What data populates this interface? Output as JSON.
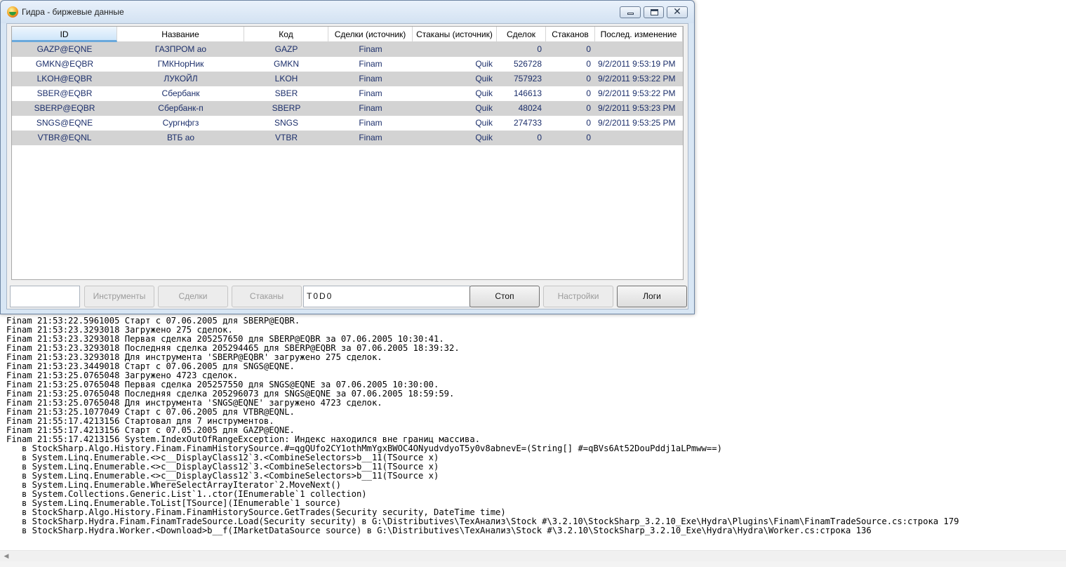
{
  "window": {
    "title": "Гидра - биржевые данные"
  },
  "grid": {
    "columns": [
      "ID",
      "Название",
      "Код",
      "Сделки (источник)",
      "Стаканы (источник)",
      "Сделок",
      "Стаканов",
      "Послед. изменение"
    ],
    "rows": [
      {
        "id": "GAZP@EQNE",
        "name": "ГАЗПРОМ ао",
        "code": "GAZP",
        "trades_src": "Finam",
        "depths_src": "",
        "trades": "0",
        "depths": "0",
        "last": ""
      },
      {
        "id": "GMKN@EQBR",
        "name": "ГМКНорНик",
        "code": "GMKN",
        "trades_src": "Finam",
        "depths_src": "Quik",
        "trades": "526728",
        "depths": "0",
        "last": "9/2/2011 9:53:19 PM"
      },
      {
        "id": "LKOH@EQBR",
        "name": "ЛУКОЙЛ",
        "code": "LKOH",
        "trades_src": "Finam",
        "depths_src": "Quik",
        "trades": "757923",
        "depths": "0",
        "last": "9/2/2011 9:53:22 PM"
      },
      {
        "id": "SBER@EQBR",
        "name": "Сбербанк",
        "code": "SBER",
        "trades_src": "Finam",
        "depths_src": "Quik",
        "trades": "146613",
        "depths": "0",
        "last": "9/2/2011 9:53:22 PM"
      },
      {
        "id": "SBERP@EQBR",
        "name": "Сбербанк-п",
        "code": "SBERP",
        "trades_src": "Finam",
        "depths_src": "Quik",
        "trades": "48024",
        "depths": "0",
        "last": "9/2/2011 9:53:23 PM"
      },
      {
        "id": "SNGS@EQNE",
        "name": "Сургнфгз",
        "code": "SNGS",
        "trades_src": "Finam",
        "depths_src": "Quik",
        "trades": "274733",
        "depths": "0",
        "last": "9/2/2011 9:53:25 PM"
      },
      {
        "id": "VTBR@EQNL",
        "name": "ВТБ ао",
        "code": "VTBR",
        "trades_src": "Finam",
        "depths_src": "Quik",
        "trades": "0",
        "depths": "0",
        "last": ""
      }
    ]
  },
  "controls": {
    "search_value": "",
    "instruments_label": "Инструменты",
    "trades_label": "Сделки",
    "depths_label": "Стаканы",
    "status_value": "T0D0",
    "stop_label": "Стоп",
    "settings_label": "Настройки",
    "logs_label": "Логи"
  },
  "log": {
    "lines": [
      "Finam 21:53:22.5961005 Старт с 07.06.2005 для SBERP@EQBR.",
      "Finam 21:53:23.3293018 Загружено 275 сделок.",
      "Finam 21:53:23.3293018 Первая сделка 205257650 для SBERP@EQBR за 07.06.2005 10:30:41.",
      "Finam 21:53:23.3293018 Последняя сделка 205294465 для SBERP@EQBR за 07.06.2005 18:39:32.",
      "Finam 21:53:23.3293018 Для инструмента 'SBERP@EQBR' загружено 275 сделок.",
      "Finam 21:53:23.3449018 Старт с 07.06.2005 для SNGS@EQNE.",
      "Finam 21:53:25.0765048 Загружено 4723 сделок.",
      "Finam 21:53:25.0765048 Первая сделка 205257550 для SNGS@EQNE за 07.06.2005 10:30:00.",
      "Finam 21:53:25.0765048 Последняя сделка 205296073 для SNGS@EQNE за 07.06.2005 18:59:59.",
      "Finam 21:53:25.0765048 Для инструмента 'SNGS@EQNE' загружено 4723 сделок.",
      "Finam 21:53:25.1077049 Старт с 07.06.2005 для VTBR@EQNL.",
      "Finam 21:55:17.4213156 Стартовал для 7 инструментов.",
      "Finam 21:55:17.4213156 Старт с 07.05.2005 для GAZP@EQNE.",
      "Finam 21:55:17.4213156 System.IndexOutOfRangeException: Индекс находился вне границ массива.",
      "   в StockSharp.Algo.History.Finam.FinamHistorySource.#=qgQUfo2CY1othMmYgxBWOC4ONyudvdyoT5y0v8abnevE=(String[] #=qBVs6At52DouPddj1aLPmww==)",
      "   в System.Linq.Enumerable.<>c__DisplayClass12`3.<CombineSelectors>b__11(TSource x)",
      "   в System.Linq.Enumerable.<>c__DisplayClass12`3.<CombineSelectors>b__11(TSource x)",
      "   в System.Linq.Enumerable.<>c__DisplayClass12`3.<CombineSelectors>b__11(TSource x)",
      "   в System.Linq.Enumerable.WhereSelectArrayIterator`2.MoveNext()",
      "   в System.Collections.Generic.List`1..ctor(IEnumerable`1 collection)",
      "   в System.Linq.Enumerable.ToList[TSource](IEnumerable`1 source)",
      "   в StockSharp.Algo.History.Finam.FinamHistorySource.GetTrades(Security security, DateTime time)",
      "   в StockSharp.Hydra.Finam.FinamTradeSource.Load(Security security) в G:\\Distributives\\ТехАнализ\\Stock #\\3.2.10\\StockSharp_3.2.10_Exe\\Hydra\\Plugins\\Finam\\FinamTradeSource.cs:строка 179",
      "   в StockSharp.Hydra.Worker.<Download>b__f(IMarketDataSource source) в G:\\Distributives\\ТехАнализ\\Stock #\\3.2.10\\StockSharp_3.2.10_Exe\\Hydra\\Hydra\\Worker.cs:строка 136"
    ]
  },
  "colors": {
    "row_shaded": "#d3d3d3",
    "cell_text": "#1c2f6b",
    "header_selected": "#6aa9dc"
  }
}
